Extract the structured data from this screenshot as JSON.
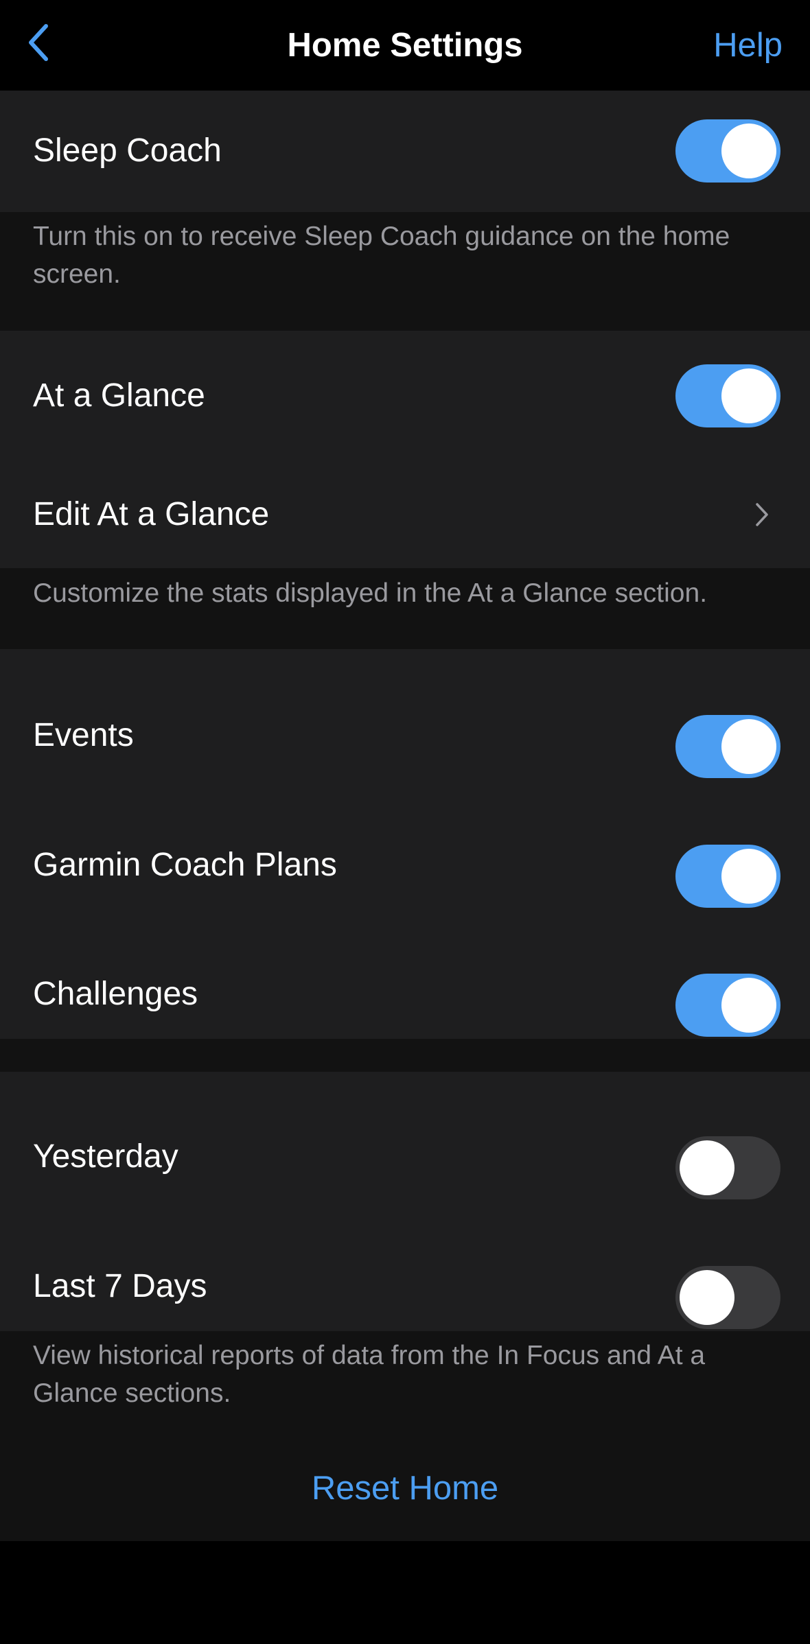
{
  "nav": {
    "title": "Home Settings",
    "help_label": "Help",
    "back_icon": "chevron-left-icon"
  },
  "colors": {
    "accent": "#4c9ef2",
    "toggle_off": "#3a3a3c",
    "section_bg": "#1e1e1f",
    "gap_bg": "#121212"
  },
  "sleep_coach": {
    "label": "Sleep Coach",
    "enabled": true,
    "note": "Turn this on to receive Sleep Coach guidance on the home screen."
  },
  "at_a_glance": {
    "label": "At a Glance",
    "enabled": true,
    "edit_label": "Edit At a Glance",
    "note": "Customize the stats displayed in the At a Glance section."
  },
  "widgets": {
    "events": {
      "label": "Events",
      "enabled": true
    },
    "coach_plans": {
      "label": "Garmin Coach Plans",
      "enabled": true
    },
    "challenges": {
      "label": "Challenges",
      "enabled": true
    }
  },
  "history": {
    "yesterday": {
      "label": "Yesterday",
      "enabled": false
    },
    "last7": {
      "label": "Last 7 Days",
      "enabled": false
    },
    "note": "View historical reports of data from the In Focus and At a Glance sections."
  },
  "reset_label": "Reset Home"
}
